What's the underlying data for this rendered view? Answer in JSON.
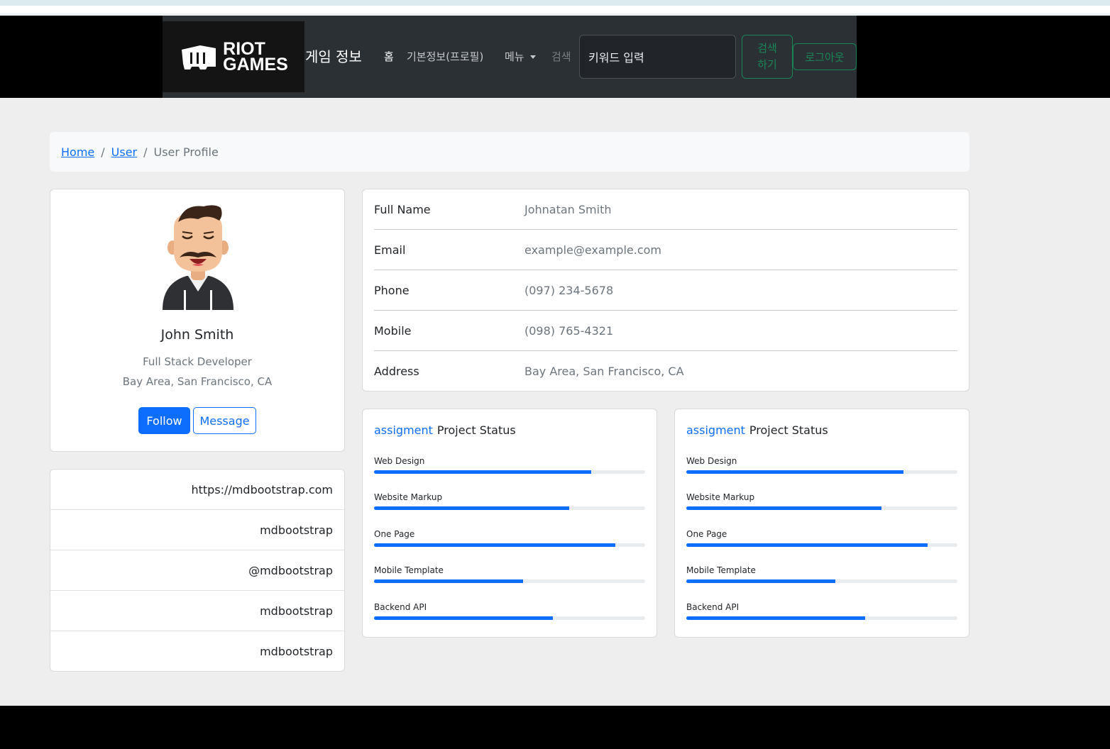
{
  "nav": {
    "logo_line1": "RIOT",
    "logo_line2": "GAMES",
    "brand": "게임 정보",
    "home": "홈",
    "profile": "기본정보(프로필)",
    "menu": "메뉴",
    "search_label": "검색",
    "search_value": "키워드 입력",
    "search_button_line1": "검색",
    "search_button_line2": "하기",
    "logout": "로그아웃"
  },
  "breadcrumb": {
    "home": "Home",
    "user": "User",
    "current": "User Profile"
  },
  "profile": {
    "name": "John Smith",
    "role": "Full Stack Developer",
    "location": "Bay Area, San Francisco, CA",
    "follow": "Follow",
    "message": "Message"
  },
  "links": [
    "https://mdbootstrap.com",
    "mdbootstrap",
    "@mdbootstrap",
    "mdbootstrap",
    "mdbootstrap"
  ],
  "info": [
    {
      "label": "Full Name",
      "value": "Johnatan Smith"
    },
    {
      "label": "Email",
      "value": "example@example.com"
    },
    {
      "label": "Phone",
      "value": "(097) 234-5678"
    },
    {
      "label": "Mobile",
      "value": "(098) 765-4321"
    },
    {
      "label": "Address",
      "value": "Bay Area, San Francisco, CA"
    }
  ],
  "projects": [
    {
      "accent": "assigment",
      "title": "Project Status",
      "items": [
        {
          "label": "Web Design",
          "percent": 80
        },
        {
          "label": "Website Markup",
          "percent": 72
        },
        {
          "label": "One Page",
          "percent": 89
        },
        {
          "label": "Mobile Template",
          "percent": 55
        },
        {
          "label": "Backend API",
          "percent": 66
        }
      ]
    },
    {
      "accent": "assigment",
      "title": "Project Status",
      "items": [
        {
          "label": "Web Design",
          "percent": 80
        },
        {
          "label": "Website Markup",
          "percent": 72
        },
        {
          "label": "One Page",
          "percent": 89
        },
        {
          "label": "Mobile Template",
          "percent": 55
        },
        {
          "label": "Backend API",
          "percent": 66
        }
      ]
    }
  ],
  "colors": {
    "primary": "#0d6efd",
    "success": "#198754",
    "navbar": "#2b3035"
  }
}
